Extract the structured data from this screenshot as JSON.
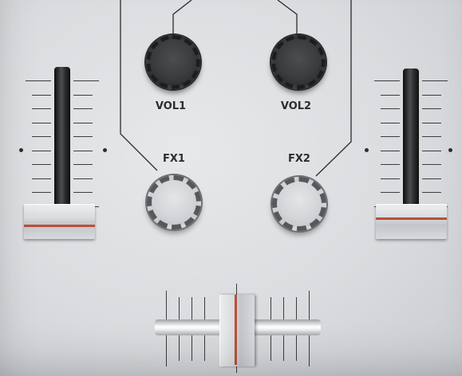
{
  "knobs": {
    "vol1": {
      "label": "VOL1"
    },
    "vol2": {
      "label": "VOL2"
    },
    "fx1": {
      "label": "FX1"
    },
    "fx2": {
      "label": "FX2"
    }
  },
  "faders": {
    "left_channel": {
      "level": 0.0
    },
    "right_channel": {
      "level": 0.0
    },
    "crossfader": {
      "position": 0.5
    }
  },
  "colors": {
    "panel": "#dcdee1",
    "knob_dark": "#3a3c3e",
    "knob_light": "#d3d5d8",
    "indicator": "#b8503a"
  }
}
